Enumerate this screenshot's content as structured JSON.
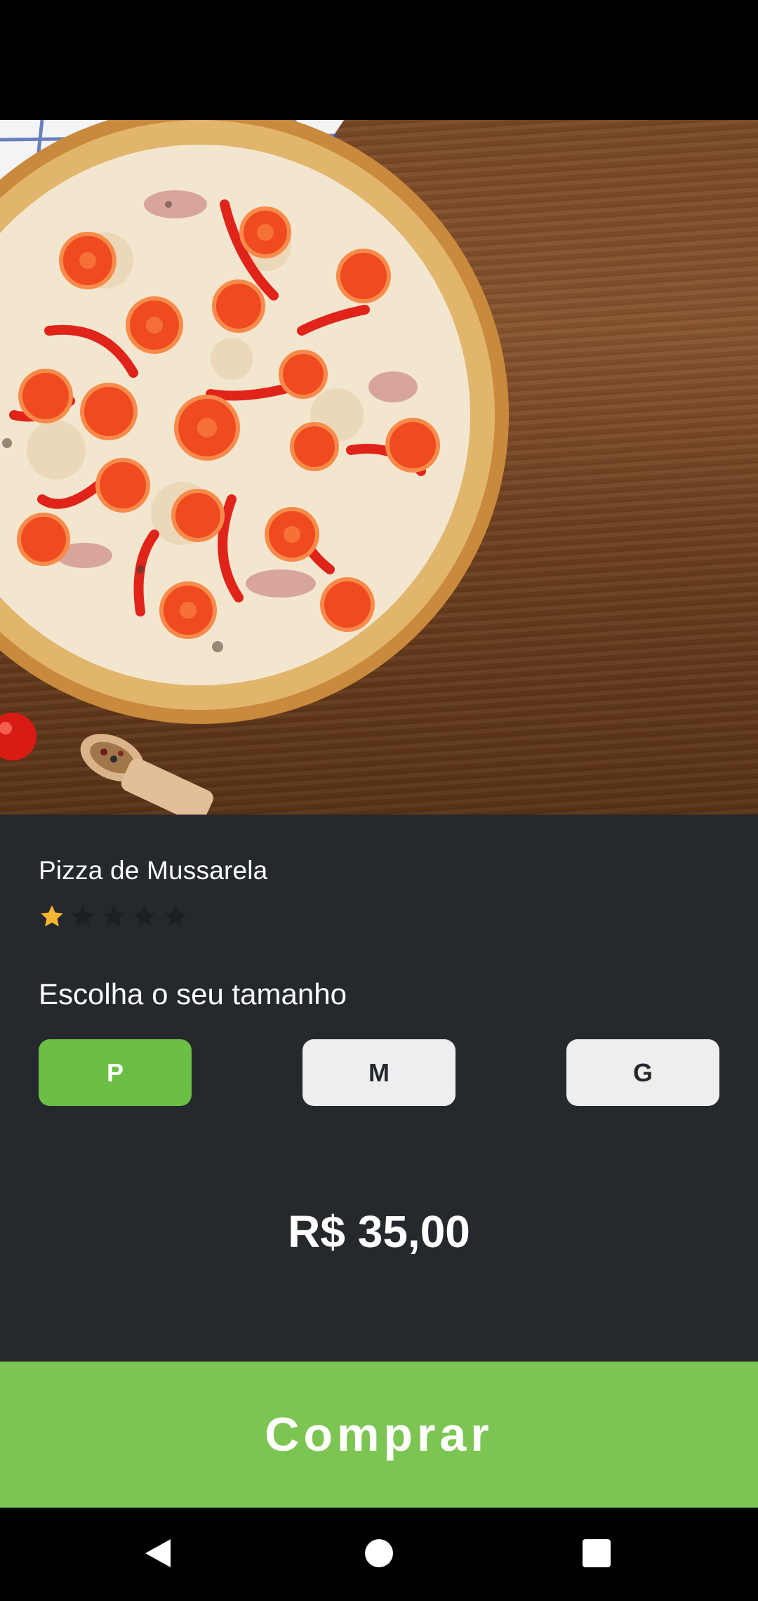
{
  "product": {
    "name": "Pizza de Mussarela",
    "rating": 1,
    "rating_max": 5,
    "image": "pizza-photo"
  },
  "size_selector": {
    "heading": "Escolha o seu tamanho",
    "options": [
      {
        "label": "P",
        "selected": true
      },
      {
        "label": "M",
        "selected": false
      },
      {
        "label": "G",
        "selected": false
      }
    ]
  },
  "price": "R$ 35,00",
  "actions": {
    "buy_label": "Comprar"
  },
  "colors": {
    "accent_green": "#7cc552",
    "selected_green": "#6cbf45",
    "panel_background": "#25282d",
    "star_filled": "#f5b731",
    "star_empty": "#1c1f23"
  },
  "nav": {
    "back_icon": "back-triangle-icon",
    "home_icon": "home-circle-icon",
    "recents_icon": "recents-square-icon"
  }
}
